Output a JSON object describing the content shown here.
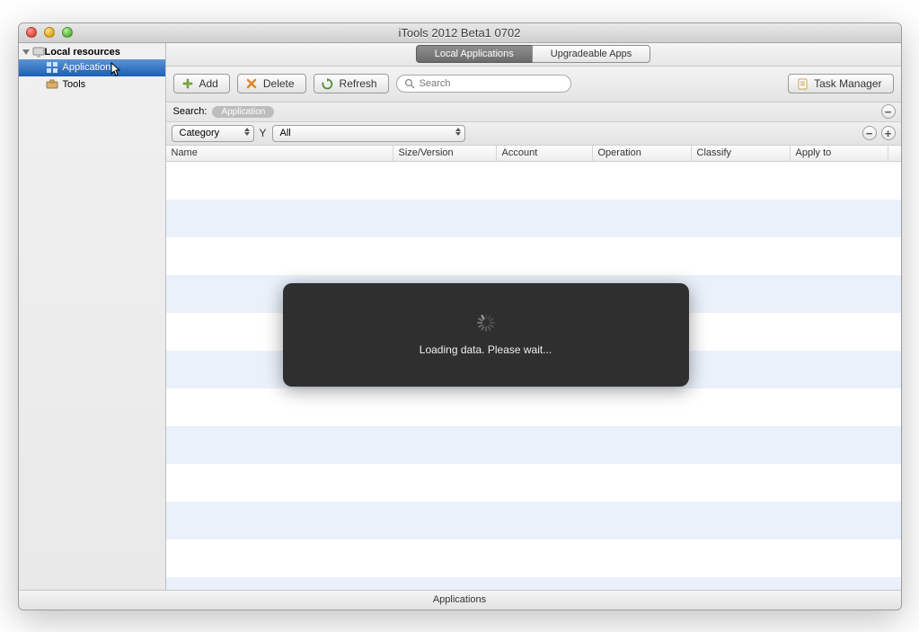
{
  "window": {
    "title": "iTools 2012 Beta1 0702"
  },
  "sidebar": {
    "root": "Local resources",
    "items": [
      {
        "label": "Applications",
        "icon": "apps-icon",
        "selected": true
      },
      {
        "label": "Tools",
        "icon": "tools-icon",
        "selected": false
      }
    ]
  },
  "tabs": {
    "items": [
      {
        "label": "Local Applications",
        "active": true
      },
      {
        "label": "Upgradeable Apps",
        "active": false
      }
    ]
  },
  "toolbar": {
    "add": "Add",
    "delete": "Delete",
    "refresh": "Refresh",
    "search_placeholder": "Search",
    "task_manager": "Task Manager"
  },
  "subbar": {
    "search_label": "Search:",
    "chip": "Application"
  },
  "filters": {
    "category": "Category",
    "letter": "Y",
    "all": "All"
  },
  "columns": {
    "name": "Name",
    "size": "Size/Version",
    "account": "Account",
    "operation": "Operation",
    "classify": "Classify",
    "apply": "Apply to"
  },
  "overlay": {
    "text": "Loading data. Please wait..."
  },
  "statusbar": {
    "text": "Applications"
  }
}
